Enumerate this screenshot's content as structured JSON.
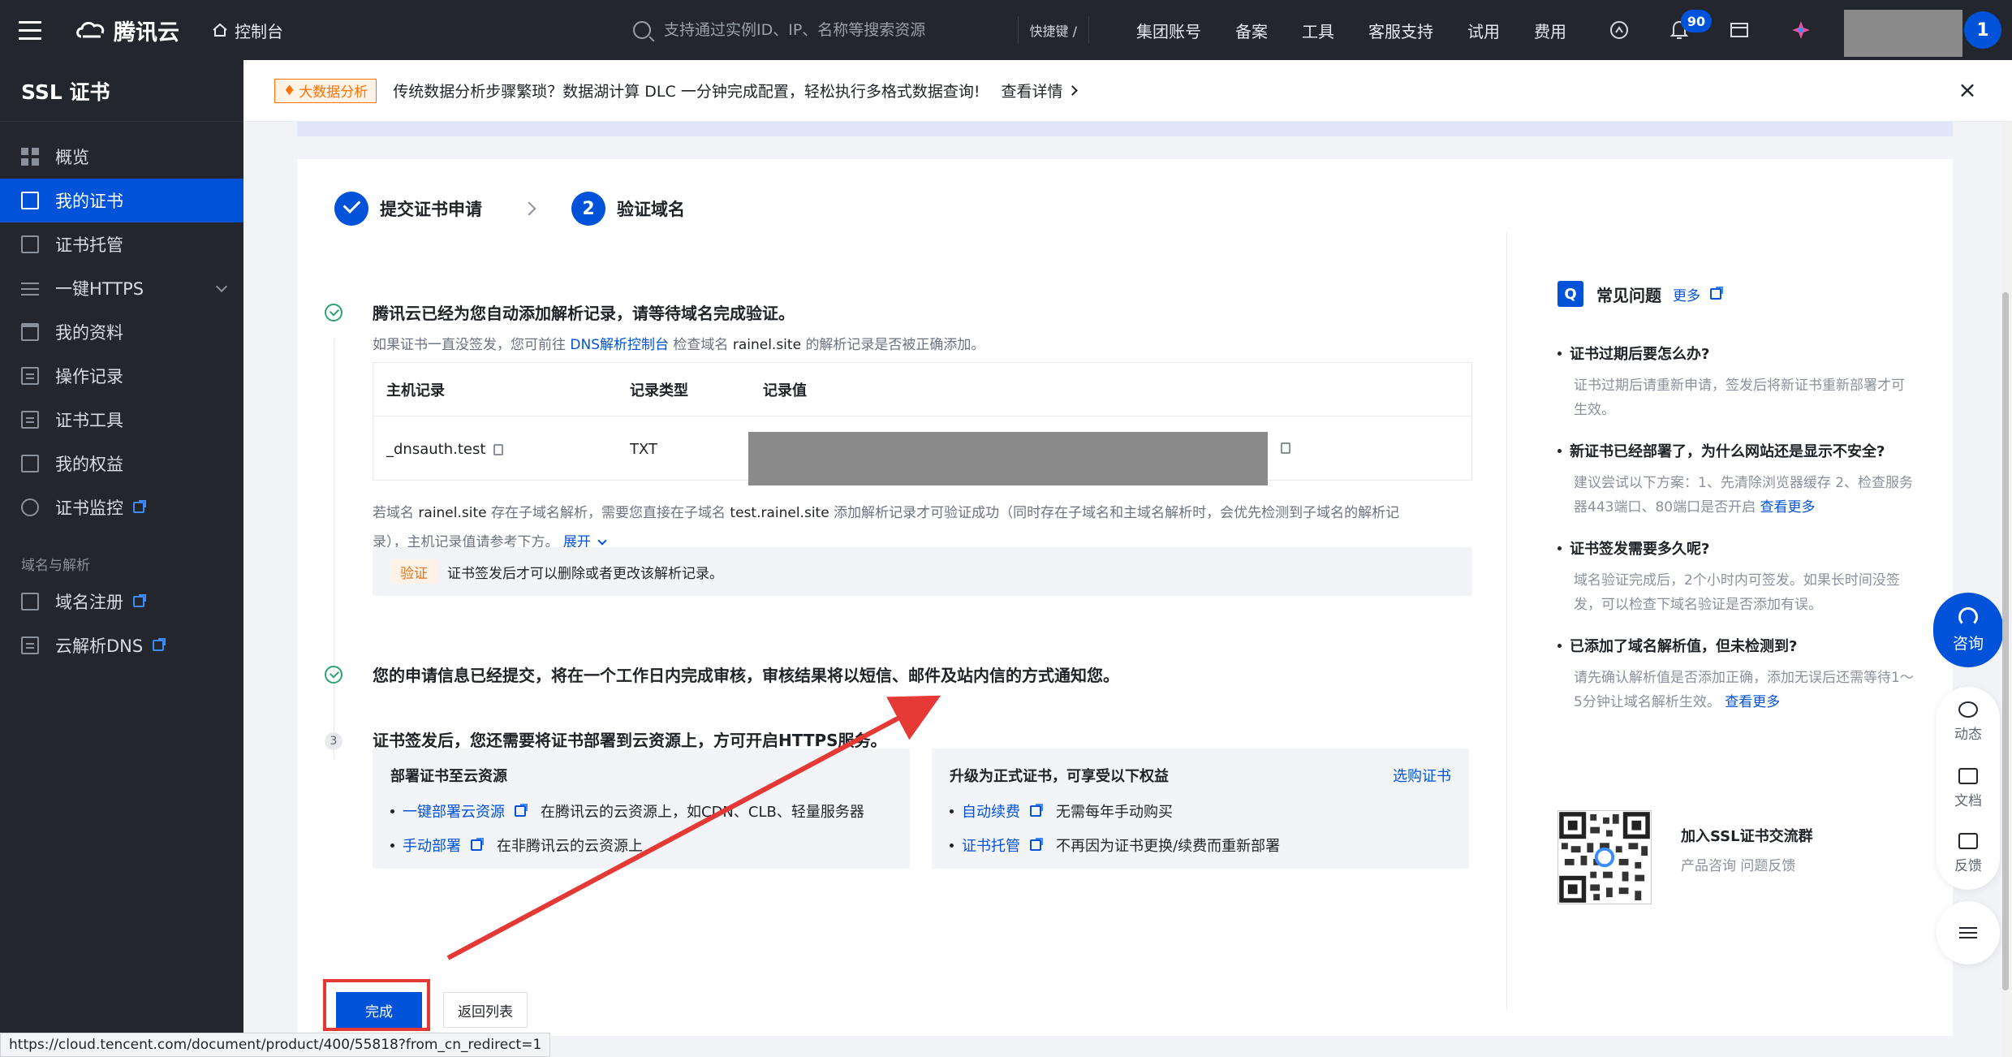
{
  "topbar": {
    "brand": "腾讯云",
    "console_label": "控制台",
    "search_placeholder": "支持通过实例ID、IP、名称等搜索资源",
    "shortcut_label": "快捷键 /",
    "nav": [
      "集团账号",
      "备案",
      "工具",
      "客服支持",
      "试用",
      "费用"
    ],
    "notification_count": "90",
    "avatar_initial": "1"
  },
  "sidebar": {
    "title": "SSL 证书",
    "items": [
      {
        "label": "概览",
        "icon": "grid-icon"
      },
      {
        "label": "我的证书",
        "icon": "certificate-icon",
        "active": true
      },
      {
        "label": "证书托管",
        "icon": "hosting-icon"
      },
      {
        "label": "一键HTTPS",
        "icon": "sliders-icon",
        "expandable": true
      },
      {
        "label": "我的资料",
        "icon": "folder-icon"
      },
      {
        "label": "操作记录",
        "icon": "document-icon"
      },
      {
        "label": "证书工具",
        "icon": "tools-icon"
      },
      {
        "label": "我的权益",
        "icon": "benefits-icon"
      },
      {
        "label": "证书监控",
        "icon": "gauge-icon",
        "external": true
      }
    ],
    "section_title": "域名与解析",
    "section_items": [
      {
        "label": "域名注册",
        "icon": "domain-icon",
        "external": true
      },
      {
        "label": "云解析DNS",
        "icon": "dns-icon",
        "external": true
      }
    ]
  },
  "banner": {
    "tag": "大数据分析",
    "text": "传统数据分析步骤繁琐？数据湖计算 DLC 一分钟完成配置，轻松执行多格式数据查询!",
    "link": "查看详情"
  },
  "steps": [
    {
      "label": "提交证书申请",
      "state": "done"
    },
    {
      "number": "2",
      "label": "验证域名",
      "state": "current"
    }
  ],
  "section1": {
    "title": "腾讯云已经为您自动添加解析记录，请等待域名完成验证。",
    "sub_prefix": "如果证书一直没签发，您可前往",
    "sub_link": "DNS解析控制台",
    "sub_mid": "检查域名",
    "sub_domain": "rainel.site",
    "sub_suffix": "的解析记录是否被正确添加。",
    "table": {
      "headers": [
        "主机记录",
        "记录类型",
        "记录值"
      ],
      "row": {
        "host": "_dnsauth.test",
        "type": "TXT",
        "value": ""
      }
    },
    "note_a": "若域名",
    "note_domain": "rainel.site",
    "note_b": "存在子域名解析，需要您直接在子域名",
    "note_sub": "test.rainel.site",
    "note_c": "添加解析记录才可验证成功（同时存在子域名和主域名解析时，会优先检测到子域名的解析记",
    "note_d": "录），主机记录值请参考下方。",
    "expand": "展开",
    "verify_tag": "验证",
    "verify_text": "证书签发后才可以删除或者更改该解析记录。"
  },
  "section2": {
    "title": "您的申请信息已经提交，将在一个工作日内完成审核，审核结果将以短信、邮件及站内信的方式通知您。"
  },
  "section3": {
    "number": "3",
    "title": "证书签发后，您还需要将证书部署到云资源上，方可开启HTTPS服务。",
    "deploy": {
      "title": "部署证书至云资源",
      "items": [
        {
          "link": "一键部署云资源",
          "desc": "在腾讯云的云资源上，如CDN、CLB、轻量服务器"
        },
        {
          "link": "手动部署",
          "desc": "在非腾讯云的云资源上"
        }
      ]
    },
    "upgrade": {
      "title": "升级为正式证书，可享受以下权益",
      "buy": "选购证书",
      "items": [
        {
          "link": "自动续费",
          "desc": "无需每年手动购买"
        },
        {
          "link": "证书托管",
          "desc": "不再因为证书更换/续费而重新部署"
        }
      ]
    }
  },
  "faq": {
    "title": "常见问题",
    "more": "更多",
    "items": [
      {
        "q": "证书过期后要怎么办?",
        "a": "证书过期后请重新申请，签发后将新证书重新部署才可生效。",
        "link": ""
      },
      {
        "q": "新证书已经部署了，为什么网站还是显示不安全?",
        "a": "建议尝试以下方案：1、先清除浏览器缓存 2、检查服务器443端口、80端口是否开启",
        "link": "查看更多"
      },
      {
        "q": "证书签发需要多久呢?",
        "a": "域名验证完成后，2个小时内可签发。如果长时间没签发，可以检查下域名验证是否添加有误。",
        "link": ""
      },
      {
        "q": "已添加了域名解析值，但未检测到?",
        "a": "请先确认解析值是否添加正确，添加无误后还需等待1～5分钟让域名解析生效。",
        "link": "查看更多"
      }
    ],
    "join_title": "加入SSL证书交流群",
    "join_sub": "产品咨询 问题反馈"
  },
  "buttons": {
    "done": "完成",
    "back": "返回列表"
  },
  "float_tools": {
    "consult": "咨询",
    "items": [
      "动态",
      "文档",
      "反馈"
    ]
  },
  "status_url": "https://cloud.tencent.com/document/product/400/55818?from_cn_redirect=1",
  "colors": {
    "brand": "#0052d9",
    "annotation": "#e53935",
    "success": "#2ba471",
    "warning": "#ff7200"
  }
}
